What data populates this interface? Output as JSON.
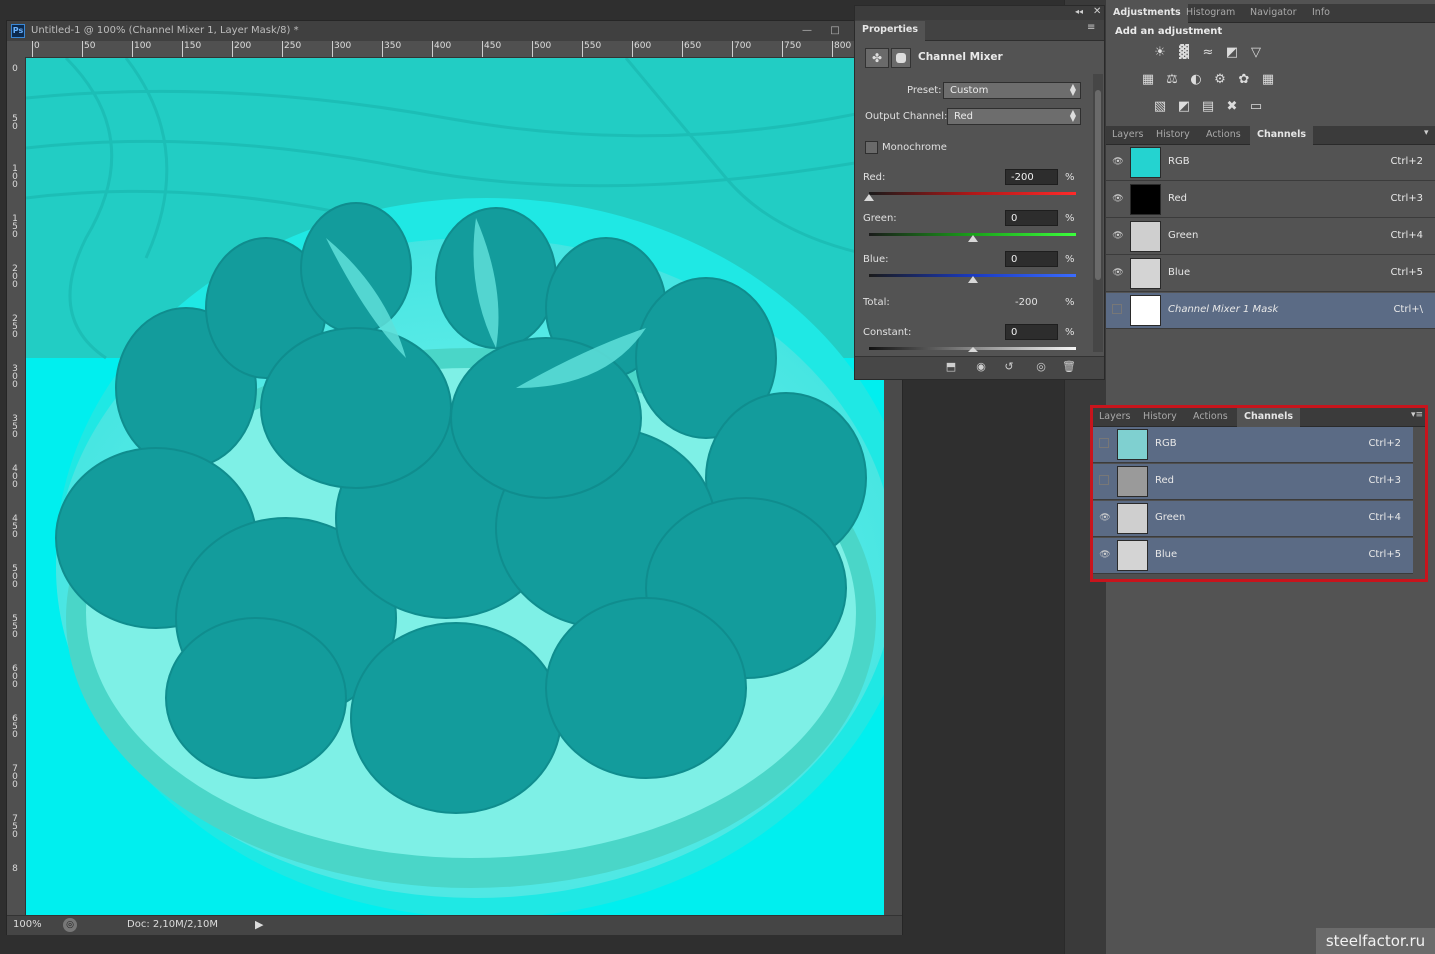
{
  "document": {
    "title": "Untitled-1 @ 100% (Channel Mixer 1, Layer Mask/8) *",
    "app_logo": "Ps",
    "minimize_glyph": "—",
    "maximize_glyph": "□",
    "ruler_top": [
      "0",
      "50",
      "100",
      "150",
      "200",
      "250",
      "300",
      "350",
      "400",
      "450",
      "500",
      "550",
      "600",
      "650",
      "700",
      "750",
      "800"
    ],
    "ruler_left": [
      "0",
      "5\n0",
      "1\n0\n0",
      "1\n5\n0",
      "2\n0\n0",
      "2\n5\n0",
      "3\n0\n0",
      "3\n5\n0",
      "4\n0\n0",
      "4\n5\n0",
      "5\n0\n0",
      "5\n5\n0",
      "6\n0\n0",
      "6\n5\n0",
      "7\n0\n0",
      "7\n5\n0",
      "8"
    ],
    "zoom": "100%",
    "doc_size": "Doc: 2,10M/2,10M",
    "canvas_color": "#00f0f0"
  },
  "properties": {
    "tab": "Properties",
    "collapse_glyph": "◂◂",
    "close_glyph": "✕",
    "menu_glyph": "≡",
    "title": "Channel Mixer",
    "preset_label": "Preset:",
    "preset_value": "Custom",
    "output_label": "Output Channel:",
    "output_value": "Red",
    "monochrome_label": "Monochrome",
    "red_label": "Red:",
    "red_value": "-200",
    "green_label": "Green:",
    "green_value": "0",
    "blue_label": "Blue:",
    "blue_value": "0",
    "total_label": "Total:",
    "total_value": "-200",
    "constant_label": "Constant:",
    "constant_value": "0",
    "pct": "%",
    "footer_icons": [
      "clip-to-layer-icon",
      "view-previous-icon",
      "reset-icon",
      "visibility-icon",
      "delete-icon"
    ]
  },
  "adjustments": {
    "tabs": [
      "Adjustments",
      "Histogram",
      "Navigator",
      "Info"
    ],
    "heading": "Add an adjustment",
    "icons_row1": [
      "☀",
      "▓",
      "≈",
      "◩",
      "▽"
    ],
    "icons_row2": [
      "▦",
      "⚖",
      "◐",
      "⚙",
      "✿",
      "▦"
    ],
    "icons_row3": [
      "▧",
      "◩",
      "▤",
      "✖",
      "▭"
    ]
  },
  "channels_top": {
    "tabs": [
      "Layers",
      "History",
      "Actions",
      "Channels"
    ],
    "rows": [
      {
        "name": "RGB",
        "shortcut": "Ctrl+2"
      },
      {
        "name": "Red",
        "shortcut": "Ctrl+3"
      },
      {
        "name": "Green",
        "shortcut": "Ctrl+4"
      },
      {
        "name": "Blue",
        "shortcut": "Ctrl+5"
      },
      {
        "name": "Channel Mixer 1 Mask",
        "shortcut": "Ctrl+\\"
      }
    ]
  },
  "channels_bottom": {
    "tabs": [
      "Layers",
      "History",
      "Actions",
      "Channels"
    ],
    "rows": [
      {
        "name": "RGB",
        "shortcut": "Ctrl+2"
      },
      {
        "name": "Red",
        "shortcut": "Ctrl+3"
      },
      {
        "name": "Green",
        "shortcut": "Ctrl+4"
      },
      {
        "name": "Blue",
        "shortcut": "Ctrl+5"
      }
    ]
  },
  "watermark": "steelfactor.ru",
  "colors": {
    "highlight": "#c8141c",
    "selected_row": "#5b6b85",
    "canvas": "#00f0f0"
  }
}
